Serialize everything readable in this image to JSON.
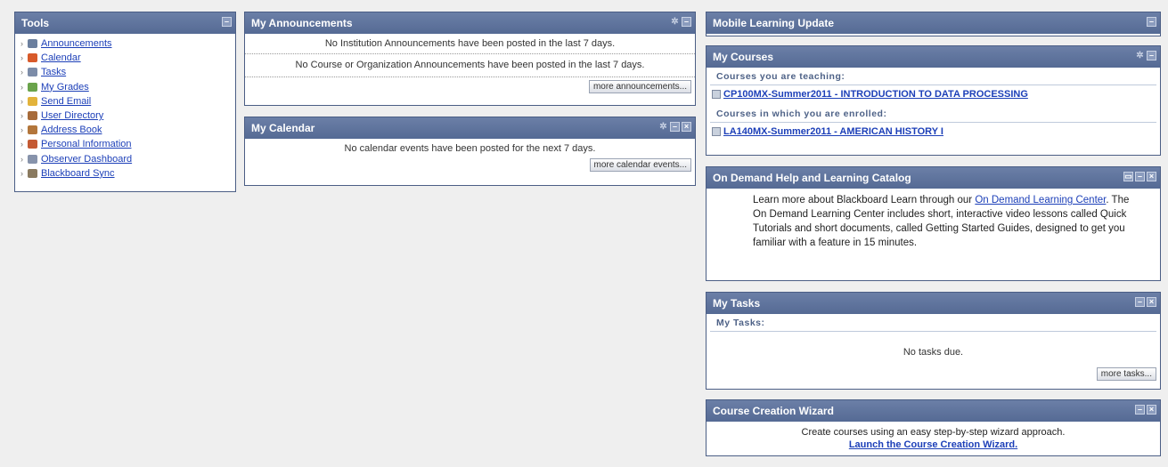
{
  "tools": {
    "title": "Tools",
    "items": [
      {
        "label": "Announcements",
        "icon": "megaphone-icon",
        "color": "#6b7f9e"
      },
      {
        "label": "Calendar",
        "icon": "calendar-icon",
        "color": "#d85a2a"
      },
      {
        "label": "Tasks",
        "icon": "tasks-icon",
        "color": "#7c8ca8"
      },
      {
        "label": "My Grades",
        "icon": "grades-icon",
        "color": "#6aa34b"
      },
      {
        "label": "Send Email",
        "icon": "email-icon",
        "color": "#e2b33b"
      },
      {
        "label": "User Directory",
        "icon": "user-directory-icon",
        "color": "#a76b3a"
      },
      {
        "label": "Address Book",
        "icon": "address-book-icon",
        "color": "#b3763b"
      },
      {
        "label": "Personal Information",
        "icon": "personal-info-icon",
        "color": "#c45a33"
      },
      {
        "label": "Observer Dashboard",
        "icon": "dashboard-icon",
        "color": "#8793ab"
      },
      {
        "label": "Blackboard Sync",
        "icon": "sync-icon",
        "color": "#8a7a5f"
      }
    ]
  },
  "announcements": {
    "title": "My Announcements",
    "institution_msg": "No Institution Announcements have been posted in the last 7 days.",
    "course_msg": "No Course or Organization Announcements have been posted in the last 7 days.",
    "more_label": "more announcements..."
  },
  "calendar": {
    "title": "My Calendar",
    "msg": "No calendar events have been posted for the next 7 days.",
    "more_label": "more calendar events..."
  },
  "mobile": {
    "title": "Mobile Learning Update"
  },
  "courses": {
    "title": "My Courses",
    "teaching_label": "Courses you are teaching:",
    "teaching_course": "CP100MX-Summer2011 - INTRODUCTION TO DATA PROCESSING",
    "enrolled_label": "Courses in which you are enrolled:",
    "enrolled_course": "LA140MX-Summer2011 - AMERICAN HISTORY I"
  },
  "help": {
    "title": "On Demand Help and Learning Catalog",
    "text_before": "Learn more about Blackboard Learn through our ",
    "link": "On Demand Learning Center",
    "text_after": ". The On Demand Learning Center includes short, interactive video lessons called Quick Tutorials and short documents, called Getting Started Guides, designed to get you familiar with a feature in 15 minutes."
  },
  "tasks": {
    "title": "My Tasks",
    "sub_label": "My Tasks:",
    "msg": "No tasks due.",
    "more_label": "more tasks..."
  },
  "wizard": {
    "title": "Course Creation Wizard",
    "text": "Create courses using an easy step-by-step wizard approach.",
    "link": "Launch the Course Creation Wizard."
  }
}
